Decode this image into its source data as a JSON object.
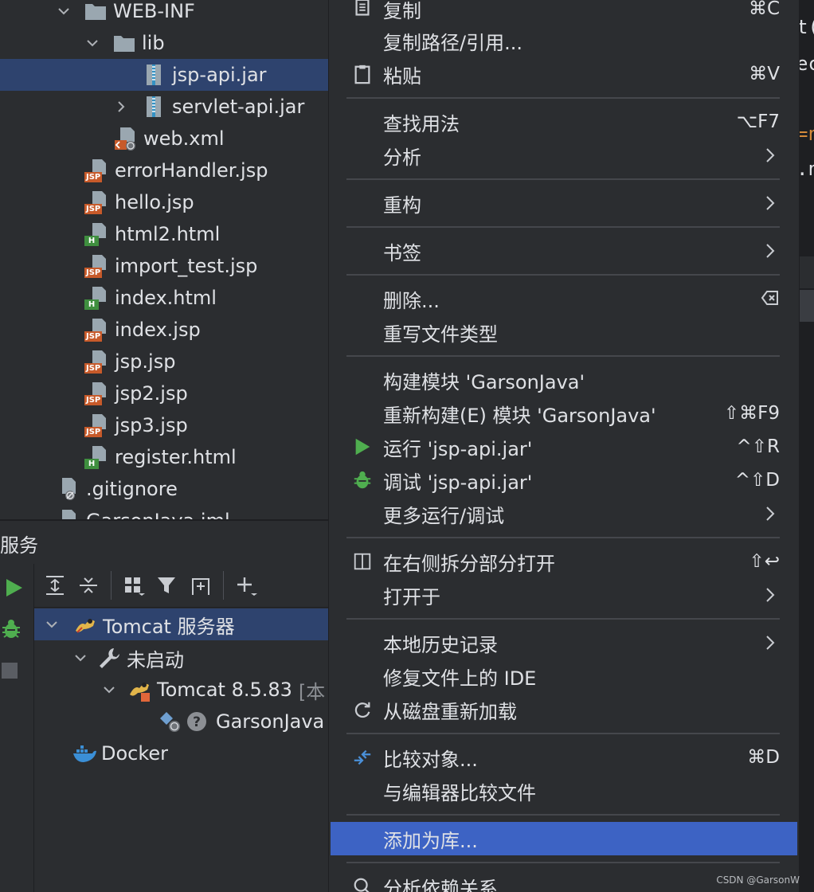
{
  "project_tree": {
    "items": [
      {
        "name": "WEB-INF",
        "type": "folder",
        "expanded": true
      },
      {
        "name": "lib",
        "type": "folder",
        "expanded": true
      },
      {
        "name": "jsp-api.jar",
        "type": "jar",
        "selected": true
      },
      {
        "name": "servlet-api.jar",
        "type": "jar",
        "collapsed": true
      },
      {
        "name": "web.xml",
        "type": "xml"
      },
      {
        "name": "errorHandler.jsp",
        "type": "jsp"
      },
      {
        "name": "hello.jsp",
        "type": "jsp"
      },
      {
        "name": "html2.html",
        "type": "html"
      },
      {
        "name": "import_test.jsp",
        "type": "jsp"
      },
      {
        "name": "index.html",
        "type": "html"
      },
      {
        "name": "index.jsp",
        "type": "jsp"
      },
      {
        "name": "jsp.jsp",
        "type": "jsp"
      },
      {
        "name": "jsp2.jsp",
        "type": "jsp"
      },
      {
        "name": "jsp3.jsp",
        "type": "jsp"
      },
      {
        "name": "register.html",
        "type": "html"
      },
      {
        "name": ".gitignore",
        "type": "ignored"
      },
      {
        "name": "GarsonJava.iml",
        "type": "iml"
      }
    ],
    "badges": {
      "jsp": "JSP",
      "html": "H"
    }
  },
  "services": {
    "title": "服务",
    "tree": {
      "tomcat_server": "Tomcat 服务器",
      "not_started": "未启动",
      "tomcat_instance": "Tomcat 8.5.83",
      "tomcat_instance_suffix": "[本",
      "artifact": "GarsonJava",
      "docker": "Docker"
    }
  },
  "context_menu": {
    "items": [
      {
        "label": "复制",
        "shortcut": "⌘C",
        "icon": "copy-icon"
      },
      {
        "label": "复制路径/引用..."
      },
      {
        "label": "粘贴",
        "shortcut": "⌘V",
        "icon": "paste-icon"
      },
      {
        "label": "查找用法",
        "shortcut": "⌥F7"
      },
      {
        "label": "分析",
        "submenu": true
      },
      {
        "label": "重构",
        "submenu": true
      },
      {
        "label": "书签",
        "submenu": true
      },
      {
        "label": "删除...",
        "icon_right": "delete-key-icon"
      },
      {
        "label": "重写文件类型"
      },
      {
        "label": "构建模块 'GarsonJava'"
      },
      {
        "label": "重新构建(E) 模块 'GarsonJava'",
        "shortcut": "⇧⌘F9"
      },
      {
        "label": "运行 'jsp-api.jar'",
        "shortcut": "^⇧R",
        "icon": "run-icon"
      },
      {
        "label": "调试 'jsp-api.jar'",
        "shortcut": "^⇧D",
        "icon": "debug-icon"
      },
      {
        "label": "更多运行/调试",
        "submenu": true
      },
      {
        "label": "在右侧拆分部分打开",
        "shortcut": "⇧↩",
        "icon": "split-icon"
      },
      {
        "label": "打开于",
        "submenu": true
      },
      {
        "label": "本地历史记录",
        "submenu": true
      },
      {
        "label": "修复文件上的 IDE"
      },
      {
        "label": "从磁盘重新加载",
        "icon": "reload-icon"
      },
      {
        "label": "比较对象...",
        "shortcut": "⌘D",
        "icon": "compare-icon"
      },
      {
        "label": "与编辑器比较文件"
      },
      {
        "label": "添加为库...",
        "highlighted": true
      },
      {
        "label": "分析依赖关系...",
        "icon": "analyze-icon"
      }
    ]
  },
  "editor_fragments": [
    "t(",
    "ec",
    "=n",
    ".n"
  ],
  "watermark": "CSDN @GarsonW",
  "colors": {
    "selection": "#2e436e",
    "menu_highlight": "#3d63c4",
    "jsp_badge": "#c75a2a",
    "html_badge": "#3f8f3f",
    "run_green": "#4fae4f"
  }
}
